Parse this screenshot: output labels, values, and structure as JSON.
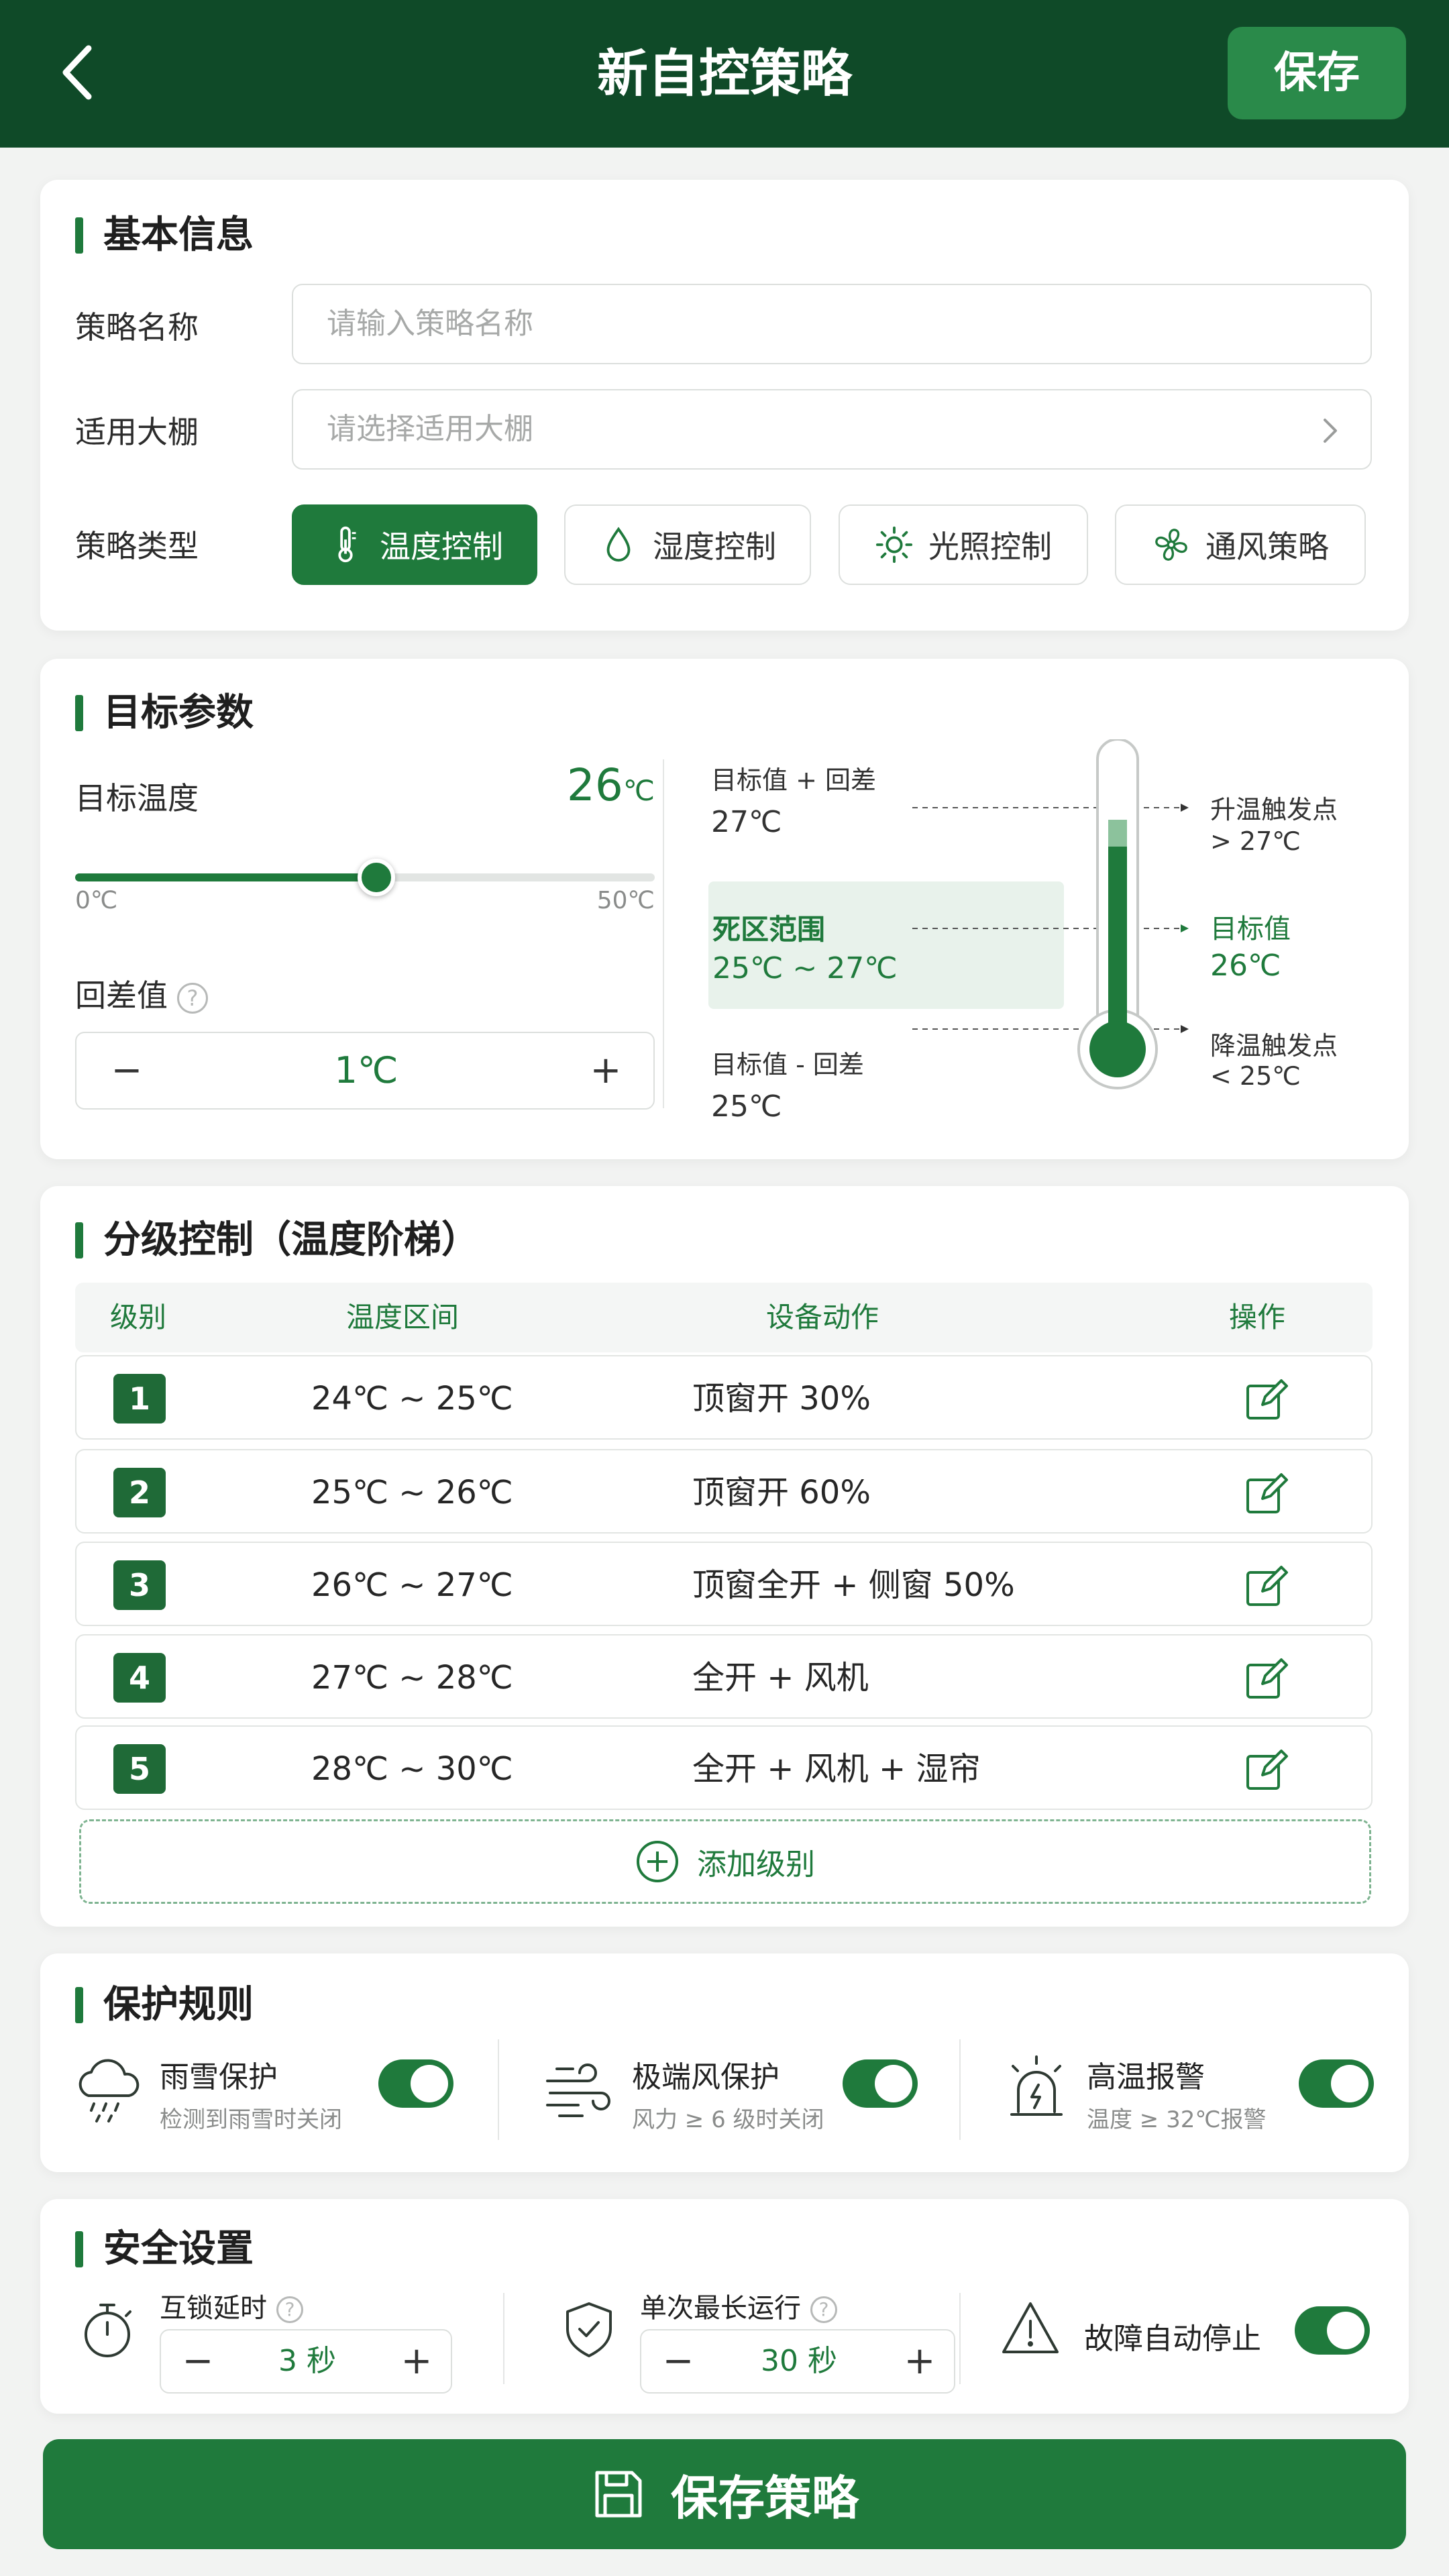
{
  "header": {
    "title": "新自控策略",
    "save_label": "保存"
  },
  "basic_info": {
    "title": "基本信息",
    "name_label": "策略名称",
    "name_placeholder": "请输入策略名称",
    "greenhouse_label": "适用大棚",
    "greenhouse_placeholder": "请选择适用大棚",
    "type_label": "策略类型",
    "types": [
      {
        "label": "温度控制",
        "icon": "thermometer-icon",
        "active": true
      },
      {
        "label": "湿度控制",
        "icon": "droplet-icon",
        "active": false
      },
      {
        "label": "光照控制",
        "icon": "sun-icon",
        "active": false
      },
      {
        "label": "通风策略",
        "icon": "fan-icon",
        "active": false
      }
    ]
  },
  "target": {
    "title": "目标参数",
    "temp_label": "目标温度",
    "temp_value": "26",
    "temp_unit": "℃",
    "slider_min": "0℃",
    "slider_max": "50℃",
    "slider_fraction": 0.52,
    "hysteresis_label": "回差值",
    "hysteresis_value": "1℃",
    "diagram": {
      "upper_label": "目标值 + 回差",
      "upper_value": "27℃",
      "dead_zone_label": "死区范围",
      "dead_zone_value": "25℃ ~ 27℃",
      "lower_label": "目标值 - 回差",
      "lower_value": "25℃",
      "heat_trigger_label": "升温触发点",
      "heat_trigger_value": "> 27℃",
      "target_label": "目标值",
      "target_value": "26℃",
      "cool_trigger_label": "降温触发点",
      "cool_trigger_value": "< 25℃"
    }
  },
  "graded": {
    "title": "分级控制（温度阶梯）",
    "columns": [
      "级别",
      "温度区间",
      "设备动作",
      "操作"
    ],
    "rows": [
      {
        "level": "1",
        "range": "24℃ ~ 25℃",
        "action": "顶窗开 30%"
      },
      {
        "level": "2",
        "range": "25℃ ~ 26℃",
        "action": "顶窗开 60%"
      },
      {
        "level": "3",
        "range": "26℃ ~ 27℃",
        "action": "顶窗全开 + 侧窗 50%"
      },
      {
        "level": "4",
        "range": "27℃ ~ 28℃",
        "action": "全开 + 风机"
      },
      {
        "level": "5",
        "range": "28℃ ~ 30℃",
        "action": "全开 + 风机 + 湿帘"
      }
    ],
    "add_label": "添加级别"
  },
  "protection": {
    "title": "保护规则",
    "rules": [
      {
        "title": "雨雪保护",
        "desc": "检测到雨雪时关闭",
        "icon": "rain-cloud-icon",
        "on": true
      },
      {
        "title": "极端风保护",
        "desc": "风力 ≥ 6 级时关闭",
        "icon": "wind-icon",
        "on": true
      },
      {
        "title": "高温报警",
        "desc": "温度 ≥ 32℃报警",
        "icon": "alarm-icon",
        "on": true
      }
    ]
  },
  "safety": {
    "title": "安全设置",
    "interlock_label": "互锁延时",
    "interlock_value": "3 秒",
    "max_run_label": "单次最长运行",
    "max_run_value": "30 秒",
    "fault_label": "故障自动停止",
    "fault_on": true
  },
  "footer": {
    "save_label": "保存策略"
  },
  "colors": {
    "primary": "#1f7a3c",
    "header": "#0f4a28"
  }
}
